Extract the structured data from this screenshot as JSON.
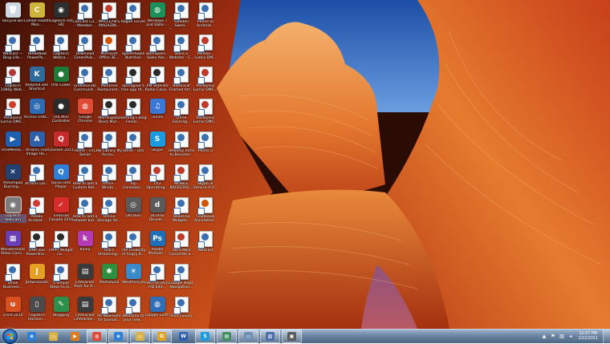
{
  "desktop": {
    "columns": [
      [
        {
          "label": "Recycle Bin",
          "icon": "recycle-bin-icon",
          "glyph": "🗑",
          "color": "#cfd8e0",
          "kind": "app"
        },
        {
          "label": "Wallcast — Bing Life...",
          "icon": "document-shortcut-icon",
          "glyph": "",
          "color": "#3a6fb0",
          "kind": "doc"
        },
        {
          "label": "Logitech 1080p Web...",
          "icon": "document-shortcut-icon",
          "glyph": "",
          "color": "#b03a3a",
          "kind": "doc"
        },
        {
          "label": "Panasonic Lumix DMC...",
          "icon": "document-shortcut-icon",
          "glyph": "",
          "color": "#d23d2b",
          "kind": "doc"
        },
        {
          "label": "FinalMedia...",
          "icon": "final-media-icon",
          "glyph": "▶",
          "color": "#1f5fb0",
          "kind": "app"
        },
        {
          "label": "Ashampoo Burning...",
          "icon": "ashampoo-icon",
          "glyph": "✕",
          "color": "#23406f",
          "kind": "app"
        },
        {
          "label": "Logitech Webcam Software",
          "icon": "logitech-webcam-icon",
          "glyph": "◉",
          "color": "#7b7b7b",
          "kind": "app",
          "selected": true
        },
        {
          "label": "Wondershare Video Conv...",
          "icon": "wondershare-icon",
          "glyph": "▦",
          "color": "#6a3fb5",
          "kind": "app"
        },
        {
          "label": "Small Business...",
          "icon": "document-shortcut-icon",
          "glyph": "",
          "color": "#3a6fb0",
          "kind": "doc"
        },
        {
          "label": "uTest 2010",
          "icon": "utest-icon",
          "glyph": "u",
          "color": "#d8501f",
          "kind": "app"
        }
      ],
      [
        {
          "label": "CoPilot Health Mon...",
          "icon": "copilot-icon",
          "glyph": "C",
          "color": "#cfb43b",
          "kind": "app"
        },
        {
          "label": "TweakNow PowerPa...",
          "icon": "document-shortcut-icon",
          "glyph": "",
          "color": "#3a6fb0",
          "kind": "doc"
        },
        {
          "label": "KeepVid.exe Shortcut",
          "icon": "keepvid-icon",
          "glyph": "K",
          "color": "#2e6a9a",
          "kind": "app"
        },
        {
          "label": "Access Orbs...",
          "icon": "access-orbs-icon",
          "glyph": "◎",
          "color": "#2d6cb3",
          "kind": "app"
        },
        {
          "label": "Acronis True Image Ho...",
          "icon": "acronis-icon",
          "glyph": "A",
          "color": "#2f5fa8",
          "kind": "app"
        },
        {
          "label": "Acronis Dis...",
          "icon": "document-shortcut-icon",
          "glyph": "",
          "color": "#3a6fb0",
          "kind": "doc"
        },
        {
          "label": "Adobe Acrobat...",
          "icon": "adobe-acrobat-icon",
          "glyph": "A",
          "color": "#d43a2f",
          "kind": "doc"
        },
        {
          "label": "DHP-302 Powerline...",
          "icon": "document-shortcut-icon",
          "glyph": "",
          "color": "#2a2a2a",
          "kind": "doc"
        },
        {
          "label": "JDownloader",
          "icon": "jdownloader-icon",
          "glyph": "J",
          "color": "#e5a021",
          "kind": "app"
        },
        {
          "label": "Logitech Harmon...",
          "icon": "logitech-harmony-icon",
          "glyph": "▯",
          "color": "#4b4b4b",
          "kind": "app"
        }
      ],
      [
        {
          "label": "Logitech Vid HD",
          "icon": "logitech-vid-icon",
          "glyph": "◉",
          "color": "#2e2e2e",
          "kind": "app"
        },
        {
          "label": "Logitech Webca...",
          "icon": "document-shortcut-icon",
          "glyph": "",
          "color": "#3a6fb0",
          "kind": "doc"
        },
        {
          "label": "Orb Codec",
          "icon": "orb-icon",
          "glyph": "●",
          "color": "#1f7a3a",
          "kind": "app"
        },
        {
          "label": "Orb Mini Controller",
          "icon": "orb-icon",
          "glyph": "●",
          "color": "#2b2b2b",
          "kind": "app"
        },
        {
          "label": "Quicken 2011",
          "icon": "quicken-icon",
          "glyph": "Q",
          "color": "#c62b2b",
          "kind": "app"
        },
        {
          "label": "QuickTime Player",
          "icon": "quicktime-icon",
          "glyph": "Q",
          "color": "#2f7fd6",
          "kind": "app"
        },
        {
          "label": "TurboTax Canada 2010",
          "icon": "turbotax-icon",
          "glyph": "✓",
          "color": "#d82b2b",
          "kind": "app"
        },
        {
          "label": "[APP] Widget co...",
          "icon": "document-shortcut-icon",
          "glyph": "",
          "color": "#2a2a2a",
          "kind": "doc"
        },
        {
          "label": "5 Simple Steps to D...",
          "icon": "document-shortcut-icon",
          "glyph": "",
          "color": "#3a6fb0",
          "kind": "doc"
        },
        {
          "label": "Blogging",
          "icon": "blogging-icon",
          "glyph": "✎",
          "color": "#2e8f4a",
          "kind": "app"
        }
      ],
      [
        {
          "label": "CanCast Co... - Member...",
          "icon": "document-shortcut-icon",
          "glyph": "",
          "color": "#3a6fb0",
          "kind": "doc"
        },
        {
          "label": "Download GreenPois...",
          "icon": "document-shortcut-icon",
          "glyph": "",
          "color": "#3a6fb0",
          "kind": "doc"
        },
        {
          "label": "Endomondo Communit...",
          "icon": "document-shortcut-icon",
          "glyph": "",
          "color": "#3a6fb0",
          "kind": "doc"
        },
        {
          "label": "Google Chrome",
          "icon": "chrome-icon",
          "glyph": "◍",
          "color": "#de4a35",
          "kind": "app"
        },
        {
          "label": "Home - HTC Sense",
          "icon": "document-shortcut-icon",
          "glyph": "",
          "color": "#3a6fb0",
          "kind": "doc"
        },
        {
          "label": "How to add a Custom Ret...",
          "icon": "document-shortcut-icon",
          "glyph": "",
          "color": "#3a6fb0",
          "kind": "doc"
        },
        {
          "label": "How to add a retweet but...",
          "icon": "document-shortcut-icon",
          "glyph": "",
          "color": "#3a6fb0",
          "kind": "doc"
        },
        {
          "label": "Kaixa",
          "icon": "kaixa-icon",
          "glyph": "k",
          "color": "#b33ab3",
          "kind": "app"
        },
        {
          "label": "Lifehacker Pack for A...",
          "icon": "lifehacker-icon",
          "glyph": "▤",
          "color": "#3a3a3a",
          "kind": "app"
        },
        {
          "label": "Lifehacker Lifehacker...",
          "icon": "lifehacker-icon",
          "glyph": "▤",
          "color": "#3a3a3a",
          "kind": "app"
        }
      ],
      [
        {
          "label": "MACLEAN'S MAGAZIN...",
          "icon": "document-shortcut-icon",
          "glyph": "",
          "color": "#c0392b",
          "kind": "doc"
        },
        {
          "label": "Microsoft Office 3E...",
          "icon": "document-shortcut-icon",
          "glyph": "",
          "color": "#d35400",
          "kind": "doc"
        },
        {
          "label": "Montreal Restaurant...",
          "icon": "document-shortcut-icon",
          "glyph": "",
          "color": "#3a6fb0",
          "kind": "doc"
        },
        {
          "label": "Morningstar Stock Mut...",
          "icon": "document-shortcut-icon",
          "glyph": "",
          "color": "#2a2a2a",
          "kind": "doc"
        },
        {
          "label": "My Library My Accou...",
          "icon": "document-shortcut-icon",
          "glyph": "",
          "color": "#3a6fb0",
          "kind": "doc"
        },
        {
          "label": "Office - Windo...",
          "icon": "document-shortcut-icon",
          "glyph": "",
          "color": "#3a6fb0",
          "kind": "doc"
        },
        {
          "label": "Online Storage Sh...",
          "icon": "document-shortcut-icon",
          "glyph": "",
          "color": "#3a6fb0",
          "kind": "doc"
        },
        {
          "label": "Orb's Streaming...",
          "icon": "document-shortcut-icon",
          "glyph": "",
          "color": "#3a6fb0",
          "kind": "doc"
        },
        {
          "label": "PhotoRuna",
          "icon": "photoruna-icon",
          "glyph": "✱",
          "color": "#2f8f3f",
          "kind": "app"
        },
        {
          "label": "PR Newswire for Journal...",
          "icon": "document-shortcut-icon",
          "glyph": "",
          "color": "#3a6fb0",
          "kind": "doc"
        }
      ],
      [
        {
          "label": "Rogue Forum",
          "icon": "document-shortcut-icon",
          "glyph": "",
          "color": "#3a6fb0",
          "kind": "doc"
        },
        {
          "label": "SparkPeople Nutrition",
          "icon": "document-shortcut-icon",
          "glyph": "",
          "color": "#3a6fb0",
          "kind": "doc"
        },
        {
          "label": "Springpad a free app th...",
          "icon": "document-shortcut-icon",
          "glyph": "",
          "color": "#2a2a2a",
          "kind": "doc"
        },
        {
          "label": "Sterling's Blog Feeds...",
          "icon": "document-shortcut-icon",
          "glyph": "",
          "color": "#2a2a2a",
          "kind": "doc"
        },
        {
          "label": "Steve - Orb",
          "icon": "document-shortcut-icon",
          "glyph": "",
          "color": "#3a6fb0",
          "kind": "doc"
        },
        {
          "label": "Top Canadian...",
          "icon": "document-shortcut-icon",
          "glyph": "",
          "color": "#3a6fb0",
          "kind": "doc"
        },
        {
          "label": "UltraISO",
          "icon": "ultraiso-icon",
          "glyph": "◎",
          "color": "#5a5a5a",
          "kind": "app"
        },
        {
          "label": "The Livability of Angry B...",
          "icon": "document-shortcut-icon",
          "glyph": "",
          "color": "#3a6fb0",
          "kind": "doc"
        },
        {
          "label": "WeatherEye",
          "icon": "weathereye-icon",
          "glyph": "☀",
          "color": "#3a89c9",
          "kind": "app"
        },
        {
          "label": "Welcome to your new...",
          "icon": "document-shortcut-icon",
          "glyph": "",
          "color": "#3a6fb0",
          "kind": "doc"
        }
      ],
      [
        {
          "label": "Windows 7 and SSDs-...",
          "icon": "windows7-icon",
          "glyph": "◍",
          "color": "#1f8f5a",
          "kind": "app"
        },
        {
          "label": "workspolis... Sales Ass...",
          "icon": "document-shortcut-icon",
          "glyph": "",
          "color": "#3a6fb0",
          "kind": "doc"
        },
        {
          "label": "XM Satellite Radio Cana...",
          "icon": "document-shortcut-icon",
          "glyph": "",
          "color": "#2a2a2a",
          "kind": "doc"
        },
        {
          "label": "iTunes",
          "icon": "itunes-icon",
          "glyph": "♫",
          "color": "#3a78d6",
          "kind": "app"
        },
        {
          "label": "Skype",
          "icon": "skype-icon",
          "glyph": "S",
          "color": "#1a9be0",
          "kind": "app"
        },
        {
          "label": "LX3 Operating...",
          "icon": "document-shortcut-icon",
          "glyph": "",
          "color": "#c0392b",
          "kind": "doc"
        },
        {
          "label": "DEVRSI Devolo...",
          "icon": "devolo-icon",
          "glyph": "d",
          "color": "#5a5a5a",
          "kind": "app"
        },
        {
          "label": "Adobe Photosh...",
          "icon": "photoshop-icon",
          "glyph": "Ps",
          "color": "#1f6fb8",
          "kind": "app"
        },
        {
          "label": "PHOTOFUN JG HD Edit...",
          "icon": "document-shortcut-icon",
          "glyph": "",
          "color": "#3a6fb0",
          "kind": "doc"
        },
        {
          "label": "Google Earth",
          "icon": "google-earth-icon",
          "glyph": "◍",
          "color": "#2f6fb8",
          "kind": "app"
        }
      ],
      [
        {
          "label": "Sweden Swed... Brands Wat...",
          "icon": "document-shortcut-icon",
          "glyph": "",
          "color": "#3a6fb0",
          "kind": "doc"
        },
        {
          "label": "Build a Website - C...",
          "icon": "document-shortcut-icon",
          "glyph": "",
          "color": "#3a6fb0",
          "kind": "doc"
        },
        {
          "label": "Botanical Framed Art...",
          "icon": "document-shortcut-icon",
          "glyph": "",
          "color": "#3a6fb0",
          "kind": "doc"
        },
        {
          "label": "QTree Silverlig...",
          "icon": "document-shortcut-icon",
          "glyph": "",
          "color": "#3a6fb0",
          "kind": "doc"
        },
        {
          "label": "Rewaley Aims to Become...",
          "icon": "document-shortcut-icon",
          "glyph": "",
          "color": "#3a6fb0",
          "kind": "doc"
        },
        {
          "label": "MOBILE BACKSTAG...",
          "icon": "document-shortcut-icon",
          "glyph": "",
          "color": "#c0392b",
          "kind": "doc"
        },
        {
          "label": "Beautiful Widgets...",
          "icon": "document-shortcut-icon",
          "glyph": "",
          "color": "#3a6fb0",
          "kind": "doc"
        },
        {
          "label": "Ultra MKV Converter a...",
          "icon": "document-shortcut-icon",
          "glyph": "",
          "color": "#c0392b",
          "kind": "doc"
        },
        {
          "label": "Google Maps Navigation...",
          "icon": "document-shortcut-icon",
          "glyph": "",
          "color": "#3a6fb0",
          "kind": "doc"
        },
        {
          "label": "Pure Luxury",
          "icon": "document-shortcut-icon",
          "glyph": "",
          "color": "#3a6fb0",
          "kind": "doc"
        }
      ],
      [
        {
          "label": "Phone to Android...",
          "icon": "document-shortcut-icon",
          "glyph": "",
          "color": "#3a6fb0",
          "kind": "doc"
        },
        {
          "label": "Panaso... Lumix DM...",
          "icon": "document-shortcut-icon",
          "glyph": "",
          "color": "#c0392b",
          "kind": "doc"
        },
        {
          "label": "Panasonic Lumix DMC...",
          "icon": "document-shortcut-icon",
          "glyph": "",
          "color": "#c0392b",
          "kind": "doc"
        },
        {
          "label": "Panasonic Lumix DMC...",
          "icon": "document-shortcut-icon",
          "glyph": "",
          "color": "#c0392b",
          "kind": "doc"
        },
        {
          "label": "Points 0",
          "icon": "document-shortcut-icon",
          "glyph": "",
          "color": "#3a6fb0",
          "kind": "doc"
        },
        {
          "label": "Skype ar Service A 0...",
          "icon": "document-shortcut-icon",
          "glyph": "",
          "color": "#3a6fb0",
          "kind": "doc"
        },
        {
          "label": "Cookbook Annotated...",
          "icon": "document-shortcut-icon",
          "glyph": "",
          "color": "#d35400",
          "kind": "doc"
        },
        {
          "label": "Wallcast",
          "icon": "document-shortcut-icon",
          "glyph": "",
          "color": "#3a6fb0",
          "kind": "doc"
        }
      ]
    ]
  },
  "taskbar": {
    "start_label": "Start",
    "pinned": [
      {
        "name": "ie-icon",
        "glyph": "e",
        "color": "#2f7fd6",
        "active": false
      },
      {
        "name": "explorer-icon",
        "glyph": "▭",
        "color": "#d8b24a",
        "active": false
      },
      {
        "name": "media-player-icon",
        "glyph": "▶",
        "color": "#e07a1f",
        "active": false
      },
      {
        "name": "chrome-icon",
        "glyph": "◍",
        "color": "#de4a35",
        "active": true
      },
      {
        "name": "ie-window-icon",
        "glyph": "e",
        "color": "#2f7fd6",
        "active": true
      },
      {
        "name": "folder-icon",
        "glyph": "▭",
        "color": "#d8b24a",
        "active": true
      },
      {
        "name": "outlook-icon",
        "glyph": "O",
        "color": "#e0a21f",
        "active": true
      },
      {
        "name": "word-icon",
        "glyph": "W",
        "color": "#2f5fb0",
        "active": false
      },
      {
        "name": "skype-icon",
        "glyph": "S",
        "color": "#1a9be0",
        "active": true
      },
      {
        "name": "network-icon",
        "glyph": "▤",
        "color": "#3f8f5f",
        "active": true
      },
      {
        "name": "window-icon",
        "glyph": "▭",
        "color": "#6f8fb5",
        "active": true
      },
      {
        "name": "photo-icon",
        "glyph": "▨",
        "color": "#4a6fa5",
        "active": true
      },
      {
        "name": "app-icon",
        "glyph": "▣",
        "color": "#5a5a5a",
        "active": true
      }
    ],
    "tray": {
      "icons": [
        {
          "name": "tray-expand-icon",
          "glyph": "▲"
        },
        {
          "name": "action-center-flag-icon",
          "glyph": "⚑"
        },
        {
          "name": "network-tray-icon",
          "glyph": "▥"
        },
        {
          "name": "volume-icon",
          "glyph": "◂"
        }
      ],
      "time": "12:57 PM",
      "date": "2/22/2011"
    }
  }
}
